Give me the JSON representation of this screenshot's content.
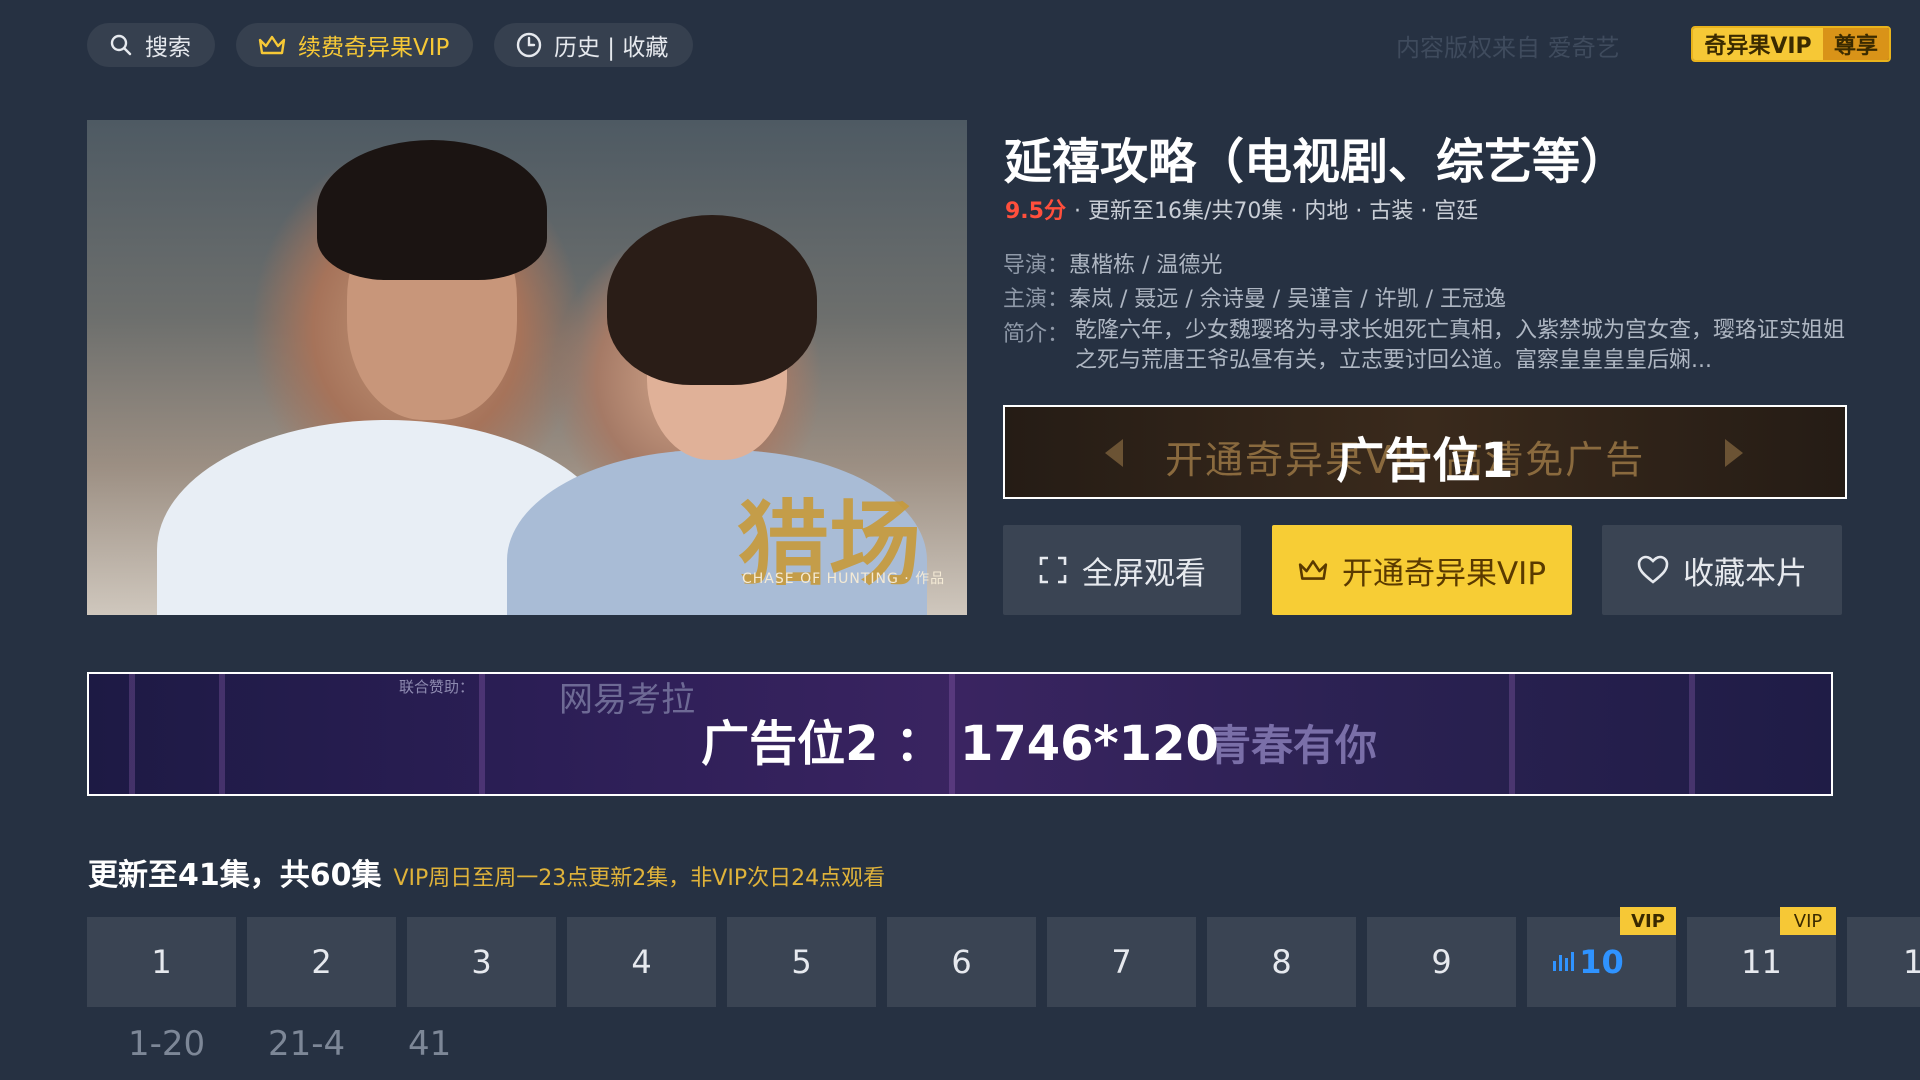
{
  "topbar": {
    "search_label": "搜索",
    "renew_vip_label": "续费奇异果VIP",
    "history_label": "历史 | 收藏",
    "copyright_text": "内容版权来自  爱奇艺",
    "vip_badge_left": "奇异果VIP",
    "vip_badge_right": "尊享"
  },
  "poster": {
    "logo_text": "猎场",
    "logo_sub": "CHASE OF HUNTING · 作品"
  },
  "show": {
    "title": "延禧攻略（电视剧、综艺等）",
    "score": "9.5分",
    "meta": "· 更新至16集/共70集 · 内地 · 古装 · 宫廷",
    "director_key": "导演：",
    "director_value": "惠楷栋 / 温德光",
    "cast_key": "主演：",
    "cast_value": "秦岚 / 聂远 / 佘诗曼 / 吴谨言 / 许凯 / 王冠逸",
    "synopsis_key": "简介：",
    "synopsis_value": "乾隆六年，少女魏璎珞为寻求长姐死亡真相，入紫禁城为宫女查，璎珞证实姐姐之死与荒唐王爷弘昼有关，立志要讨回公道。富察皇皇皇皇后娴..."
  },
  "ad1": {
    "background_text": "开通奇异果VIP  高清免广告",
    "label": "广告位1"
  },
  "buttons": {
    "fullscreen_label": "全屏观看",
    "open_vip_label": "开通奇异果VIP",
    "favorite_label": "收藏本片"
  },
  "ad2": {
    "label": "广告位2 ： 1746*120",
    "sponsor": "联合赞助：",
    "brand": "网易考拉",
    "show": "青春有你"
  },
  "episodes": {
    "header": "更新至41集，共60集",
    "note": "VIP周日至周一23点更新2集，非VIP次日24点观看",
    "vip_tag": "VIP",
    "items": [
      "1",
      "2",
      "3",
      "4",
      "5",
      "6",
      "7",
      "8",
      "9",
      "10",
      "11",
      "1"
    ],
    "ranges": [
      "1-20",
      "21-4",
      "41"
    ]
  },
  "colors": {
    "background": "#263142",
    "accent_gold": "#f6c836",
    "score_red": "#ff4f3c",
    "active_blue": "#2f93ff"
  }
}
